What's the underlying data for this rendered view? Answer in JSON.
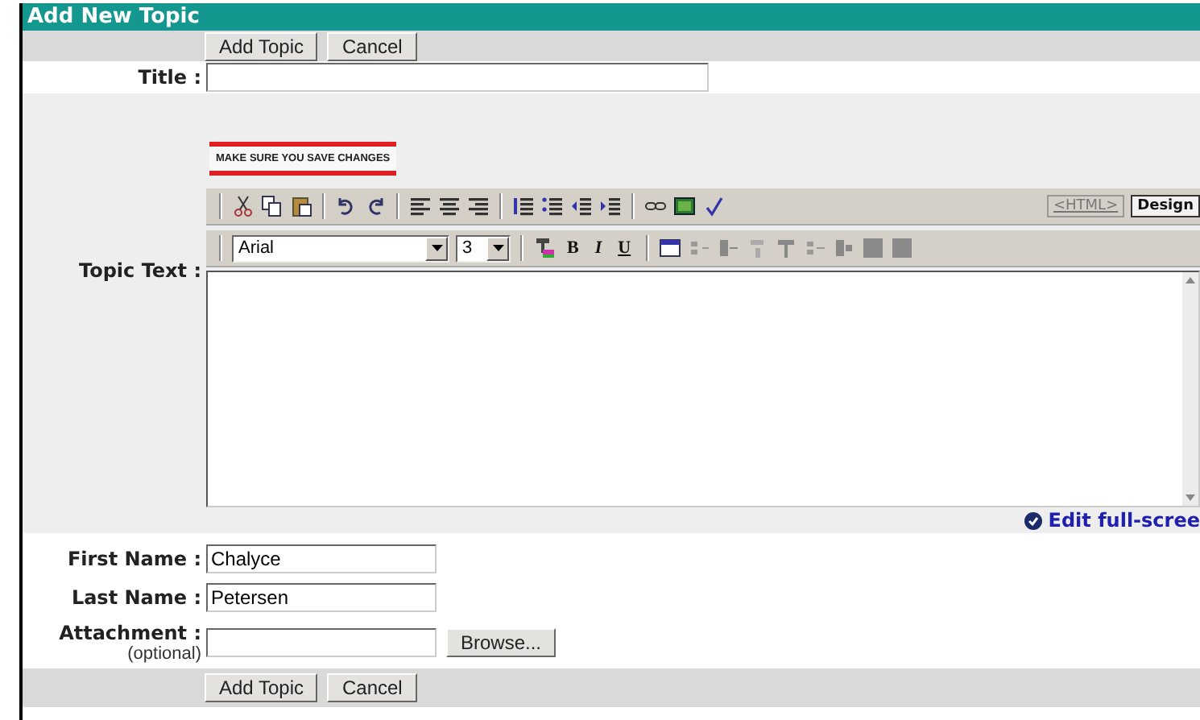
{
  "header": {
    "title": "Add New Topic"
  },
  "top_buttons": [
    "Add Topic",
    "Cancel"
  ],
  "title_field": {
    "label": "Title :"
  },
  "editor": {
    "label": "Topic Text :",
    "notice": "MAKE SURE YOU SAVE CHANGES",
    "modes": [
      {
        "label": "<HTML>",
        "selected": false
      },
      {
        "label": "Design",
        "selected": true
      }
    ],
    "font": "Arial",
    "size": "3",
    "format_buttons": [
      "B",
      "I",
      "U"
    ],
    "full_screen_link": "Edit full-scree"
  },
  "fields": [
    {
      "label": "First Name :",
      "value": "Chalyce"
    },
    {
      "label": "Last Name :",
      "value": "Petersen"
    }
  ],
  "attachment": {
    "label": "Attachment :",
    "hint": "(optional)",
    "button": "Browse..."
  },
  "bottom_buttons": [
    "Add Topic",
    "Cancel"
  ]
}
